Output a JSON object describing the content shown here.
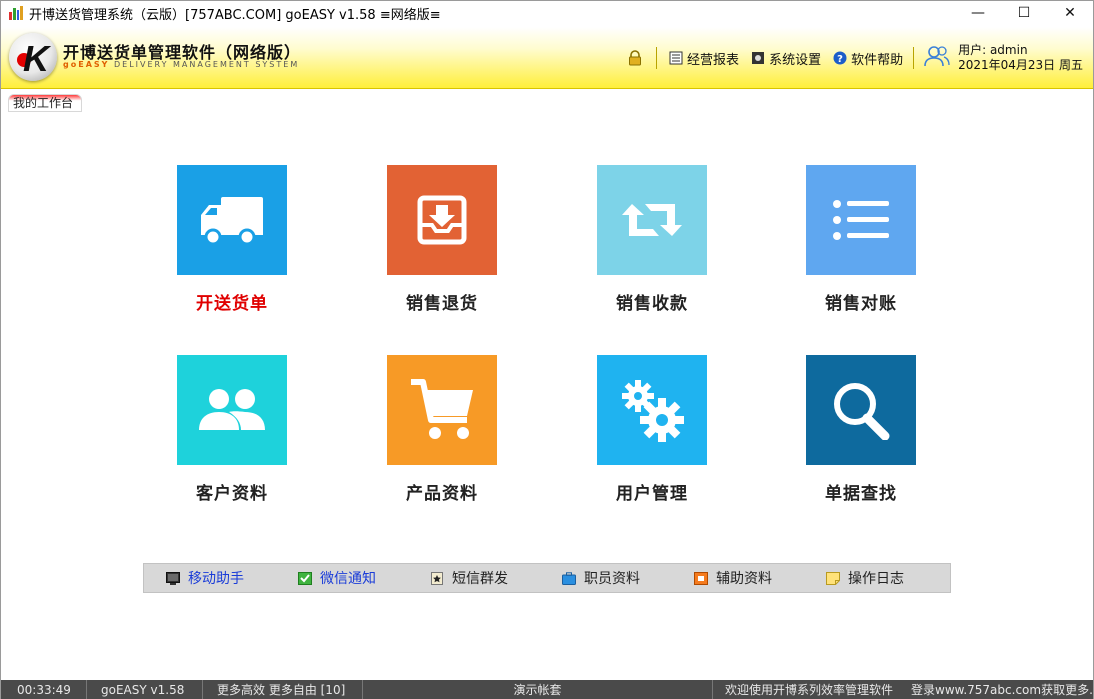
{
  "window": {
    "title": "开博送货管理系统（云版）[757ABC.COM]   goEASY v1.58   ≡网络版≡",
    "minimize": "—",
    "maximize": "☐",
    "close": "✕"
  },
  "brand": {
    "logo_letter": "K",
    "title": "开博送货单管理软件（网络版）",
    "sub_highlight": "goEASY",
    "sub_rest": " DELIVERY MANAGEMENT SYSTEM"
  },
  "header_menu": {
    "lock_icon": "lock-icon",
    "reports": "经营报表",
    "settings": "系统设置",
    "help": "软件帮助",
    "user_label": "用户: admin",
    "date": "2021年04月23日 周五"
  },
  "tab": {
    "label": "我的工作台"
  },
  "tiles": [
    {
      "label": "开送货单",
      "color": "#1aa0e6",
      "icon": "truck-icon"
    },
    {
      "label": "销售退货",
      "color": "#e26234",
      "icon": "inbox-download-icon"
    },
    {
      "label": "销售收款",
      "color": "#7dd3e8",
      "icon": "retweet-icon"
    },
    {
      "label": "销售对账",
      "color": "#5fa7f0",
      "icon": "list-icon"
    },
    {
      "label": "客户资料",
      "color": "#1ed2db",
      "icon": "users-icon"
    },
    {
      "label": "产品资料",
      "color": "#f79a26",
      "icon": "cart-icon"
    },
    {
      "label": "用户管理",
      "color": "#1fb3f0",
      "icon": "gears-icon"
    },
    {
      "label": "单据查找",
      "color": "#0e6a9e",
      "icon": "search-icon"
    }
  ],
  "quickbar": [
    {
      "label": "移动助手",
      "style": "blue",
      "icon": "monitor-icon"
    },
    {
      "label": "微信通知",
      "style": "blue",
      "icon": "check-icon"
    },
    {
      "label": "短信群发",
      "style": "black",
      "icon": "star-note-icon"
    },
    {
      "label": "职员资料",
      "style": "black",
      "icon": "briefcase-icon"
    },
    {
      "label": "辅助资料",
      "style": "black",
      "icon": "box-icon"
    },
    {
      "label": "操作日志",
      "style": "black",
      "icon": "note-icon"
    }
  ],
  "statusbar": {
    "time": "00:33:49",
    "version": "goEASY v1.58",
    "slogan": "更多高效 更多自由 [10]",
    "account": "演示帐套",
    "welcome": "欢迎使用开博系列效率管理软件",
    "login": "登录www.757abc.com获取更多..."
  }
}
